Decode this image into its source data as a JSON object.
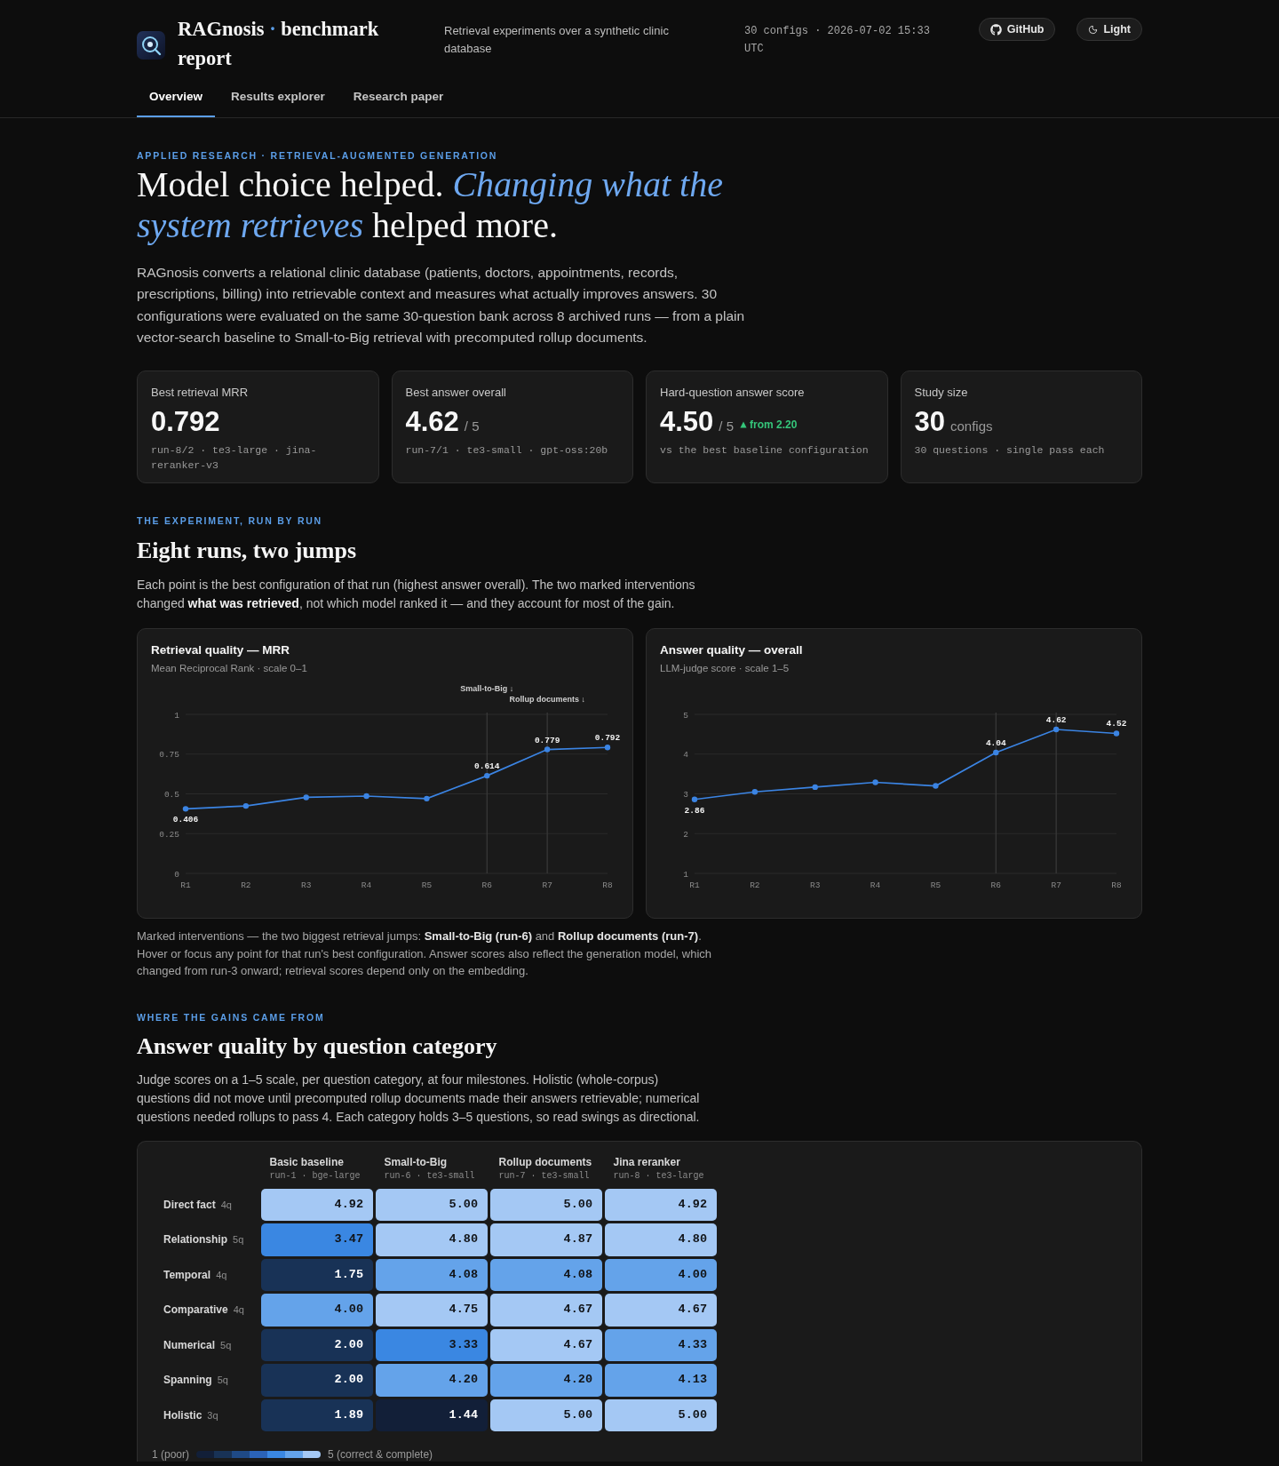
{
  "header": {
    "title_parts": [
      {
        "text": "RAGnosis",
        "accent": false
      },
      {
        "text": "·",
        "accent": true
      },
      {
        "text": "benchmark report",
        "accent": false
      }
    ],
    "tagline": "Retrieval experiments over a synthetic clinic database",
    "meta": "30 configs · 2026-07-02 15:33 UTC",
    "buttons": [
      {
        "kind": "github",
        "label": "GitHub"
      },
      {
        "kind": "theme",
        "label": "Light"
      }
    ]
  },
  "tabs": [
    {
      "label": "Overview",
      "selected": true
    },
    {
      "label": "Results explorer",
      "selected": false
    },
    {
      "label": "Research paper",
      "selected": false
    }
  ],
  "hero": {
    "eyebrow": "APPLIED RESEARCH · RETRIEVAL-AUGMENTED GENERATION",
    "heading": "Model choice helped. *Changing what the system retrieves* helped more.",
    "intro": "RAGnosis converts a relational clinic database (patients, doctors, appointments, records, prescriptions, billing) into retrievable context and measures what actually improves answers. 30 configurations were evaluated on the same 30-question bank across 8 archived runs — from a plain vector-search baseline to Small-to-Big retrieval with precomputed rollup documents."
  },
  "stats": [
    {
      "label": "Best retrieval MRR",
      "value": "0.792",
      "detail": "run-8/2 · te3-large · jina-reranker-v3"
    },
    {
      "label": "Best answer overall",
      "value": "4.62",
      "unit": "/ 5",
      "detail": "run-7/1 · te3-small · gpt-oss:20b"
    },
    {
      "label": "Hard-question answer score",
      "value": "4.50",
      "unit": "/ 5",
      "delta": "from 2.20",
      "detail": "vs the best baseline configuration"
    },
    {
      "label": "Study size",
      "value": "30",
      "unit": "configs",
      "detail": "30 questions · single pass each"
    }
  ],
  "runs_section": {
    "eyebrow": "THE EXPERIMENT, RUN BY RUN",
    "heading": "Eight runs, two jumps",
    "intro": "Each point is the best configuration of that run (highest answer overall). The two marked interventions changed **what was retrieved**, not which model ranked it — and they account for most of the gain.",
    "charts": [
      {
        "subtitle": "Mean Reciprocal Rank · scale 0–1",
        "chart_data": {
          "type": "line",
          "title": "Retrieval quality — MRR",
          "categories": [
            "R1",
            "R2",
            "R3",
            "R4",
            "R5",
            "R6",
            "R7",
            "R8"
          ],
          "series": [
            {
              "color": "#3b84e3",
              "marker": "circle",
              "values": [
                0.406,
                0.424,
                0.478,
                0.486,
                0.47,
                0.614,
                0.779,
                0.792
              ]
            }
          ],
          "ylim": [
            0,
            1
          ],
          "yticks": [
            0,
            0.25,
            0.5,
            0.75,
            1
          ],
          "grid": true,
          "value_labels": [
            "0.406",
            null,
            null,
            null,
            null,
            "0.614",
            "0.779",
            "0.792"
          ],
          "ref_lines": [
            {
              "axis": "x",
              "value": "R6"
            },
            {
              "axis": "x",
              "value": "R7"
            }
          ],
          "annotations": [
            "Small-to-Big ↓",
            "Rollup documents ↓"
          ]
        }
      },
      {
        "subtitle": "LLM-judge score · scale 1–5",
        "chart_data": {
          "type": "line",
          "title": "Answer quality — overall",
          "categories": [
            "R1",
            "R2",
            "R3",
            "R4",
            "R5",
            "R6",
            "R7",
            "R8"
          ],
          "series": [
            {
              "color": "#3b84e3",
              "marker": "circle",
              "values": [
                2.86,
                3.05,
                3.17,
                3.29,
                3.2,
                4.04,
                4.62,
                4.52
              ]
            }
          ],
          "ylim": [
            1,
            5
          ],
          "yticks": [
            1,
            2,
            3,
            4,
            5
          ],
          "grid": true,
          "value_labels": [
            "2.86",
            null,
            null,
            null,
            null,
            "4.04",
            "4.62",
            "4.52"
          ],
          "ref_lines": [
            {
              "axis": "x",
              "value": "R6"
            },
            {
              "axis": "x",
              "value": "R7"
            }
          ]
        }
      }
    ],
    "caption": "Marked interventions — the two biggest retrieval jumps: **Small-to-Big (run-6)** and **Rollup documents (run-7)**. Hover or focus any point for that run's best configuration. Answer scores also reflect the generation model, which changed from run-3 onward; retrieval scores depend only on the embedding."
  },
  "categories_section": {
    "eyebrow": "WHERE THE GAINS CAME FROM",
    "heading": "Answer quality by question category",
    "intro": "Judge scores on a 1–5 scale, per question category, at four milestones. Holistic (whole-corpus) questions did not move until precomputed rollup documents made their answers retrievable; numerical questions needed rollups to pass 4. Each category holds 3–5 questions, so read swings as directional.",
    "heatmap": {
      "columns": [
        {
          "name": "Basic baseline",
          "run": "run-1 · bge-large"
        },
        {
          "name": "Small-to-Big",
          "run": "run-6 · te3-small"
        },
        {
          "name": "Rollup documents",
          "run": "run-7 · te3-small"
        },
        {
          "name": "Jina reranker",
          "run": "run-8 · te3-large"
        }
      ],
      "rows": [
        {
          "category": "Direct fact",
          "count": "4q",
          "cells": [
            {
              "value": "4.92",
              "color": "#a4c8f4"
            },
            {
              "value": "5.00",
              "color": "#a4c8f4"
            },
            {
              "value": "5.00",
              "color": "#a4c8f4"
            },
            {
              "value": "4.92",
              "color": "#a4c8f4"
            }
          ]
        },
        {
          "category": "Relationship",
          "count": "5q",
          "cells": [
            {
              "value": "3.47",
              "color": "#3a87e2"
            },
            {
              "value": "4.80",
              "color": "#a4c8f4"
            },
            {
              "value": "4.87",
              "color": "#a4c8f4"
            },
            {
              "value": "4.80",
              "color": "#a4c8f4"
            }
          ]
        },
        {
          "category": "Temporal",
          "count": "4q",
          "cells": [
            {
              "value": "1.75",
              "color": "#183256"
            },
            {
              "value": "4.08",
              "color": "#64a3ea"
            },
            {
              "value": "4.08",
              "color": "#64a3ea"
            },
            {
              "value": "4.00",
              "color": "#64a3ea"
            }
          ]
        },
        {
          "category": "Comparative",
          "count": "4q",
          "cells": [
            {
              "value": "4.00",
              "color": "#64a3ea"
            },
            {
              "value": "4.75",
              "color": "#a4c8f4"
            },
            {
              "value": "4.67",
              "color": "#a4c8f4"
            },
            {
              "value": "4.67",
              "color": "#a4c8f4"
            }
          ]
        },
        {
          "category": "Numerical",
          "count": "5q",
          "cells": [
            {
              "value": "2.00",
              "color": "#183256"
            },
            {
              "value": "3.33",
              "color": "#3a87e2"
            },
            {
              "value": "4.67",
              "color": "#a4c8f4"
            },
            {
              "value": "4.33",
              "color": "#64a3ea"
            }
          ]
        },
        {
          "category": "Spanning",
          "count": "5q",
          "cells": [
            {
              "value": "2.00",
              "color": "#183256"
            },
            {
              "value": "4.20",
              "color": "#64a3ea"
            },
            {
              "value": "4.20",
              "color": "#64a3ea"
            },
            {
              "value": "4.13",
              "color": "#64a3ea"
            }
          ]
        },
        {
          "category": "Holistic",
          "count": "3q",
          "cells": [
            {
              "value": "1.89",
              "color": "#183256"
            },
            {
              "value": "1.44",
              "color": "#121f38"
            },
            {
              "value": "5.00",
              "color": "#a4c8f4"
            },
            {
              "value": "5.00",
              "color": "#a4c8f4"
            }
          ]
        }
      ],
      "legend": {
        "low": "1 (poor)",
        "high": "5 (correct & complete)"
      }
    }
  }
}
